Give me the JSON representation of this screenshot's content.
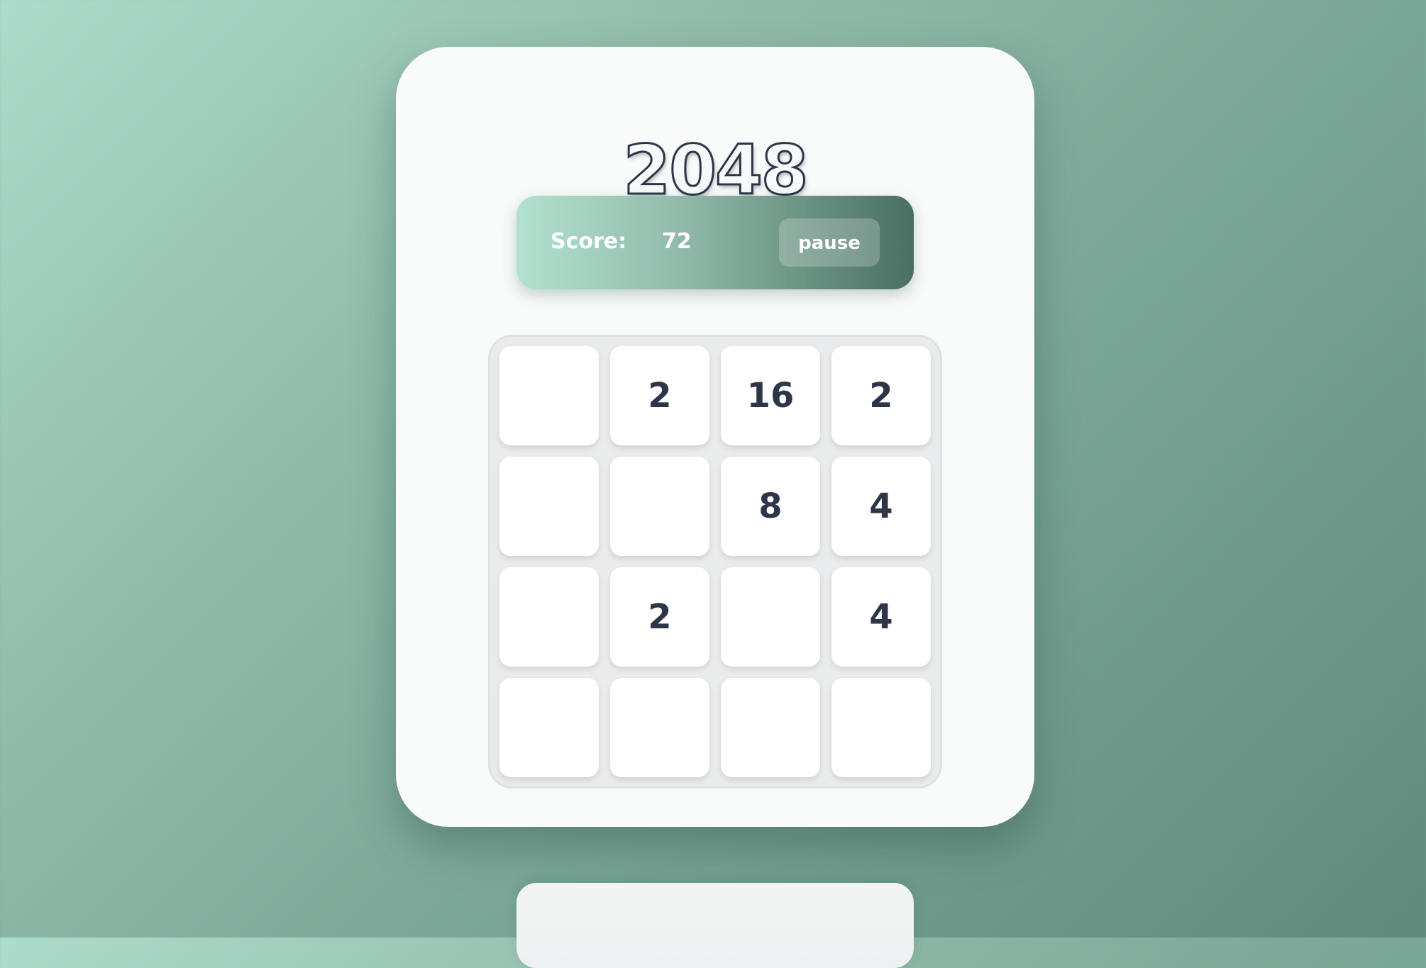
{
  "game": {
    "title": "2048",
    "score_label": "Score:",
    "score_value": "72",
    "pause_label": "pause"
  },
  "board": {
    "rows": [
      [
        "",
        "2",
        "16",
        "2"
      ],
      [
        "",
        "",
        "8",
        "4"
      ],
      [
        "",
        "2",
        "",
        "4"
      ],
      [
        "",
        "",
        "",
        ""
      ]
    ]
  },
  "bottom_panel": {
    "peek_text": ""
  },
  "colors": {
    "background_start": "#acdccb",
    "background_end": "#5f8a7c",
    "card": "#f9fafa",
    "score_bar_start": "#b2e2cf",
    "score_bar_end": "#4a6e63",
    "board": "#e9ebec",
    "tile": "#ffffff",
    "tile_text": "#2d3648",
    "title_stroke": "#2d3648"
  }
}
